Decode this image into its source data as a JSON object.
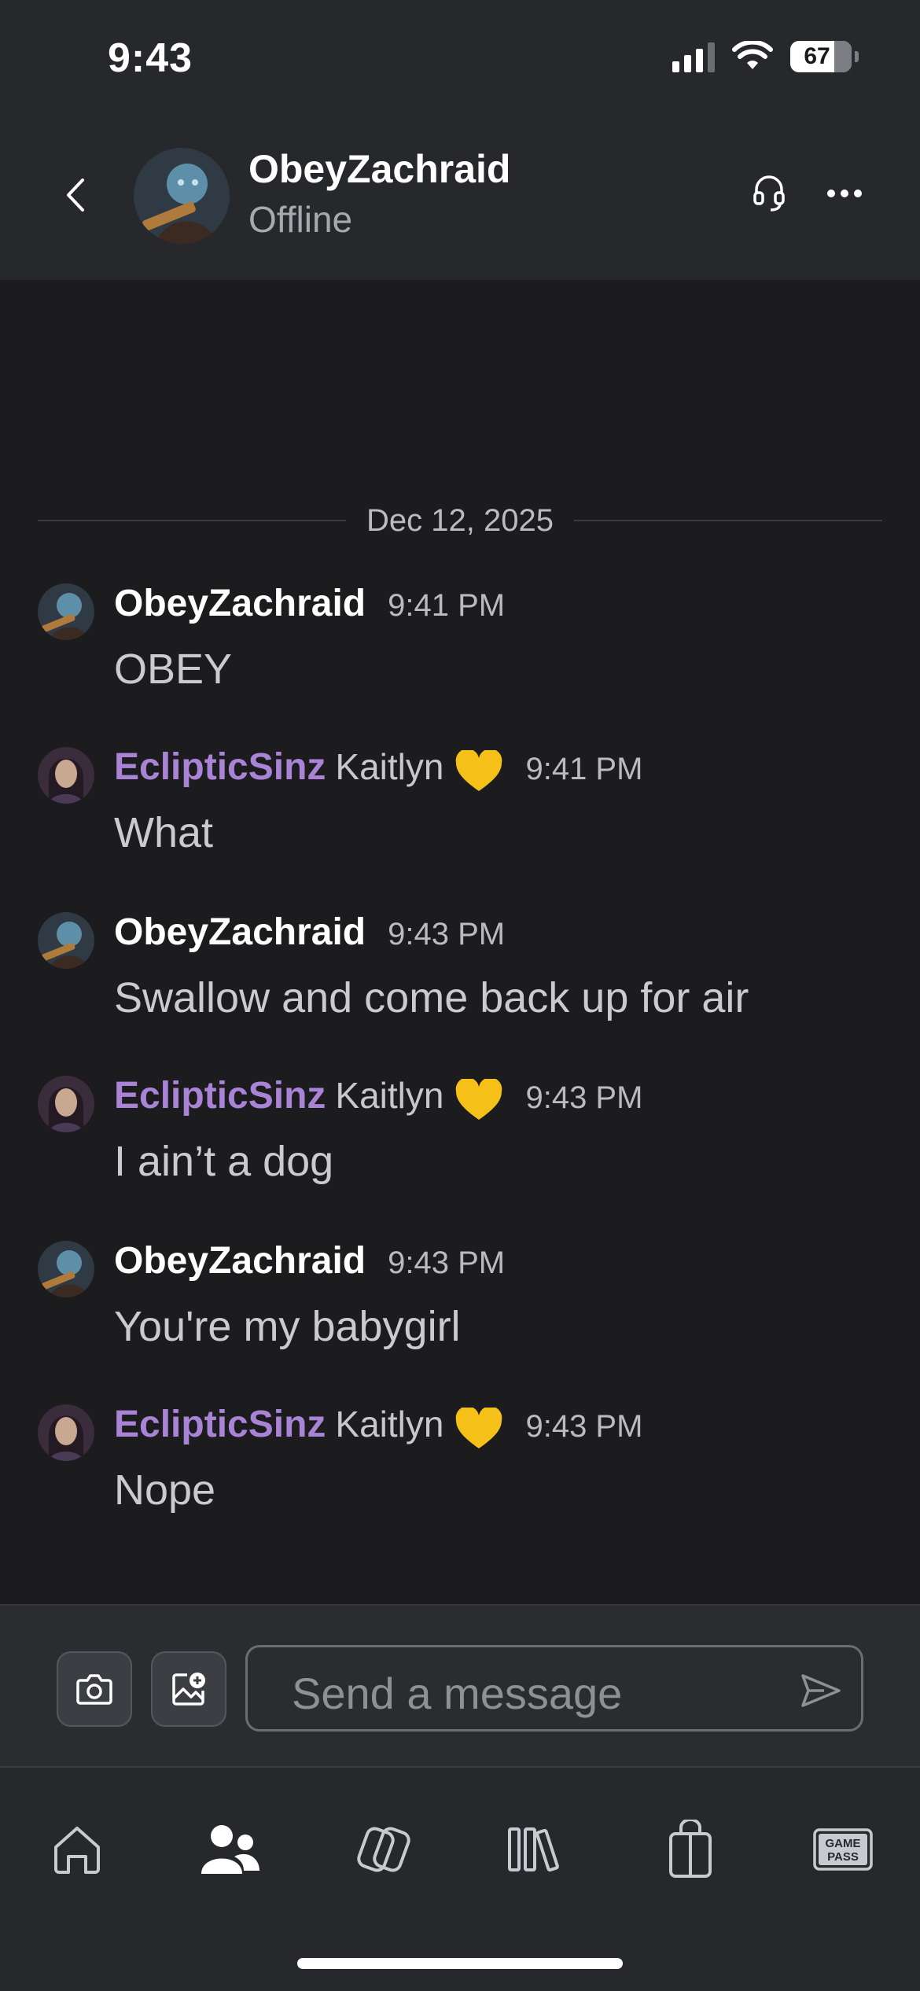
{
  "status_bar": {
    "time": "9:43",
    "battery": "67",
    "icons": [
      "signal-icon",
      "wifi-icon",
      "battery-icon"
    ]
  },
  "header": {
    "back_icon": "chevron-left-icon",
    "contact_name": "ObeyZachraid",
    "contact_status": "Offline",
    "actions": [
      "headset-icon",
      "more-icon"
    ]
  },
  "chat": {
    "date_separator": "Dec 12, 2025",
    "messages": [
      {
        "sender": "ObeyZachraid",
        "nickname": "",
        "time": "9:41 PM",
        "text": "OBEY"
      },
      {
        "sender": "EclipticSinz",
        "nickname": "Kaitlyn",
        "time": "9:41 PM",
        "text": "What"
      },
      {
        "sender": "ObeyZachraid",
        "nickname": "",
        "time": "9:43 PM",
        "text": "Swallow and come back up for air"
      },
      {
        "sender": "EclipticSinz",
        "nickname": "Kaitlyn",
        "time": "9:43 PM",
        "text": "I ain’t a dog"
      },
      {
        "sender": "ObeyZachraid",
        "nickname": "",
        "time": "9:43 PM",
        "text": "You're my babygirl"
      },
      {
        "sender": "EclipticSinz",
        "nickname": "Kaitlyn",
        "time": "9:43 PM",
        "text": "Nope"
      }
    ]
  },
  "composer": {
    "placeholder": "Send a message",
    "value": "",
    "buttons": [
      "camera-icon",
      "add-image-icon",
      "send-icon"
    ]
  },
  "bottom_nav": {
    "items": [
      "home-icon",
      "friends-icon",
      "cloud-gaming-icon",
      "library-icon",
      "store-icon",
      "game-pass-icon"
    ],
    "active": "friends-icon",
    "game_pass_badge": [
      "GAME",
      "PASS"
    ]
  },
  "colors": {
    "background": "#1c1c1f",
    "panel": "#26282c",
    "accent_purple": "#a983d6",
    "heart": "#f5c018"
  }
}
